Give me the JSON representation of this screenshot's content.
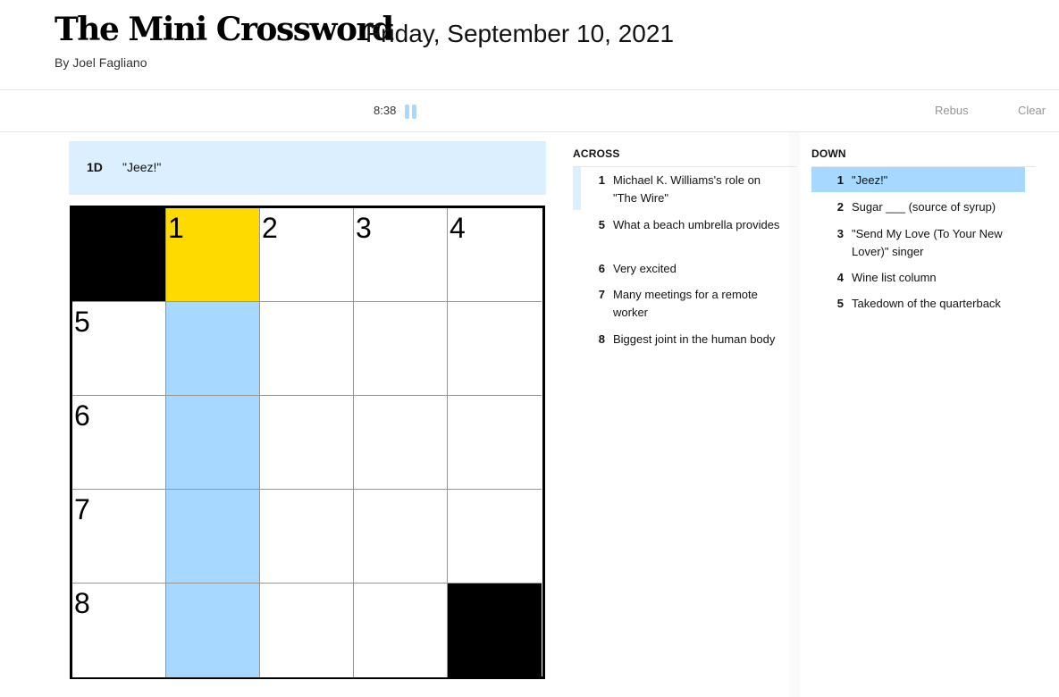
{
  "header": {
    "title": "The Mini Crossword",
    "date": "Friday, September 10, 2021",
    "byline": "By Joel Fagliano"
  },
  "toolbar": {
    "timer": "8:38",
    "pause_icon": "pause-icon",
    "rebus_label": "Rebus",
    "clear_label": "Clear"
  },
  "active_clue": {
    "number": "1D",
    "text": "\"Jeez!\""
  },
  "board": {
    "rows": [
      [
        "black",
        "1",
        "2",
        "3",
        "4"
      ],
      [
        "5",
        "",
        "",
        "",
        ""
      ],
      [
        "6",
        "",
        "",
        "",
        ""
      ],
      [
        "7",
        "",
        "",
        "",
        ""
      ],
      [
        "8",
        "",
        "",
        "",
        "black"
      ]
    ],
    "selected_cell": [
      0,
      1
    ],
    "highlight_column": 1,
    "colors": {
      "selected": "#ffda00",
      "highlight": "#a7d8ff",
      "black": "#000000"
    }
  },
  "across": {
    "title": "ACROSS",
    "clues": [
      {
        "num": "1",
        "text": "Michael K. Williams's role on \"The Wire\""
      },
      {
        "num": "5",
        "text": "What a beach umbrella provides"
      },
      {
        "num": "6",
        "text": "Very excited"
      },
      {
        "num": "7",
        "text": "Many meetings for a remote worker"
      },
      {
        "num": "8",
        "text": "Biggest joint in the human body"
      }
    ]
  },
  "down": {
    "title": "DOWN",
    "clues": [
      {
        "num": "1",
        "text": "\"Jeez!\""
      },
      {
        "num": "2",
        "text": "Sugar ___ (source of syrup)"
      },
      {
        "num": "3",
        "text": "\"Send My Love (To Your New Lover)\" singer"
      },
      {
        "num": "4",
        "text": "Wine list column"
      },
      {
        "num": "5",
        "text": "Takedown of the quarterback"
      }
    ]
  }
}
